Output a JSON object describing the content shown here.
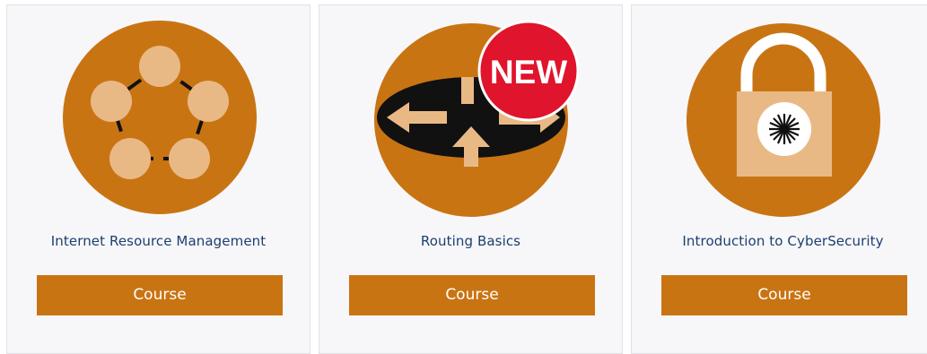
{
  "colors": {
    "accent": "#c97413",
    "title_text": "#1b3f70",
    "card_bg": "#f7f7f9",
    "badge": "#e0142c"
  },
  "cards": [
    {
      "title": "Internet Resource Management",
      "button_label": "Course",
      "icon": "network-ring-icon"
    },
    {
      "title": "Routing Basics",
      "button_label": "Course",
      "icon": "router-arrows-icon",
      "badge": "NEW"
    },
    {
      "title": "Introduction to CyberSecurity",
      "button_label": "Course",
      "icon": "padlock-icon"
    }
  ]
}
